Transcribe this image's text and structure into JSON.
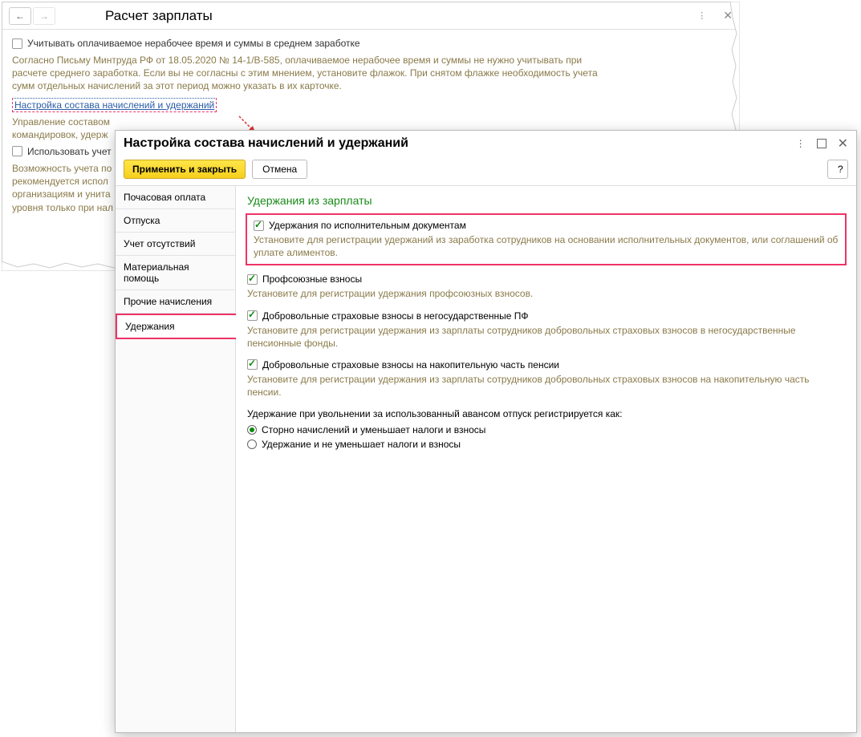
{
  "bg": {
    "title": "Расчет зарплаты",
    "chk1": "Учитывать оплачиваемое нерабочее время и суммы в среднем заработке",
    "para": "Согласно Письму Минтруда РФ от 18.05.2020 № 14-1/В-585, оплачиваемое нерабочее время и суммы не нужно учитывать при расчете среднего заработка. Если вы не согласны с этим мнением, установите флажок. При снятом флажке необходимость учета сумм отдельных начислений за этот период можно указать в их карточке.",
    "link": "Настройка состава начислений и удержаний",
    "para2a": "Управление составом",
    "para2b": "командировок, удерж",
    "chk2": "Использовать учет",
    "para3a": "Возможность учета по",
    "para3b": "рекомендуется испол",
    "para3c": "организациям и унита",
    "para3d": "уровня только при нал"
  },
  "modal": {
    "title": "Настройка состава начислений и удержаний",
    "apply": "Применить и закрыть",
    "cancel": "Отмена",
    "help": "?",
    "tabs": [
      "Почасовая оплата",
      "Отпуска",
      "Учет отсутствий",
      "Материальная помощь",
      "Прочие начисления",
      "Удержания"
    ],
    "content": {
      "title": "Удержания из зарплаты",
      "items": [
        {
          "chk": "Удержания по исполнительным документам",
          "desc": "Установите для регистрации удержаний из заработка сотрудников на основании исполнительных документов, или соглашений об уплате алиментов."
        },
        {
          "chk": "Профсоюзные взносы",
          "desc": "Установите для регистрации удержания профсоюзных взносов."
        },
        {
          "chk": "Добровольные страховые взносы в негосударственные ПФ",
          "desc": "Установите для регистрации удержания из зарплаты сотрудников добровольных страховых взносов в негосударственные пенсионные фонды."
        },
        {
          "chk": "Добровольные страховые взносы на накопительную часть пенсии",
          "desc": "Установите для регистрации удержания из зарплаты сотрудников добровольных страховых взносов на накопительную часть пенсии."
        }
      ],
      "radio_title": "Удержание при увольнении за использованный авансом отпуск регистрируется как:",
      "radios": [
        "Сторно начислений и уменьшает налоги и взносы",
        "Удержание и не уменьшает налоги и взносы"
      ]
    }
  }
}
